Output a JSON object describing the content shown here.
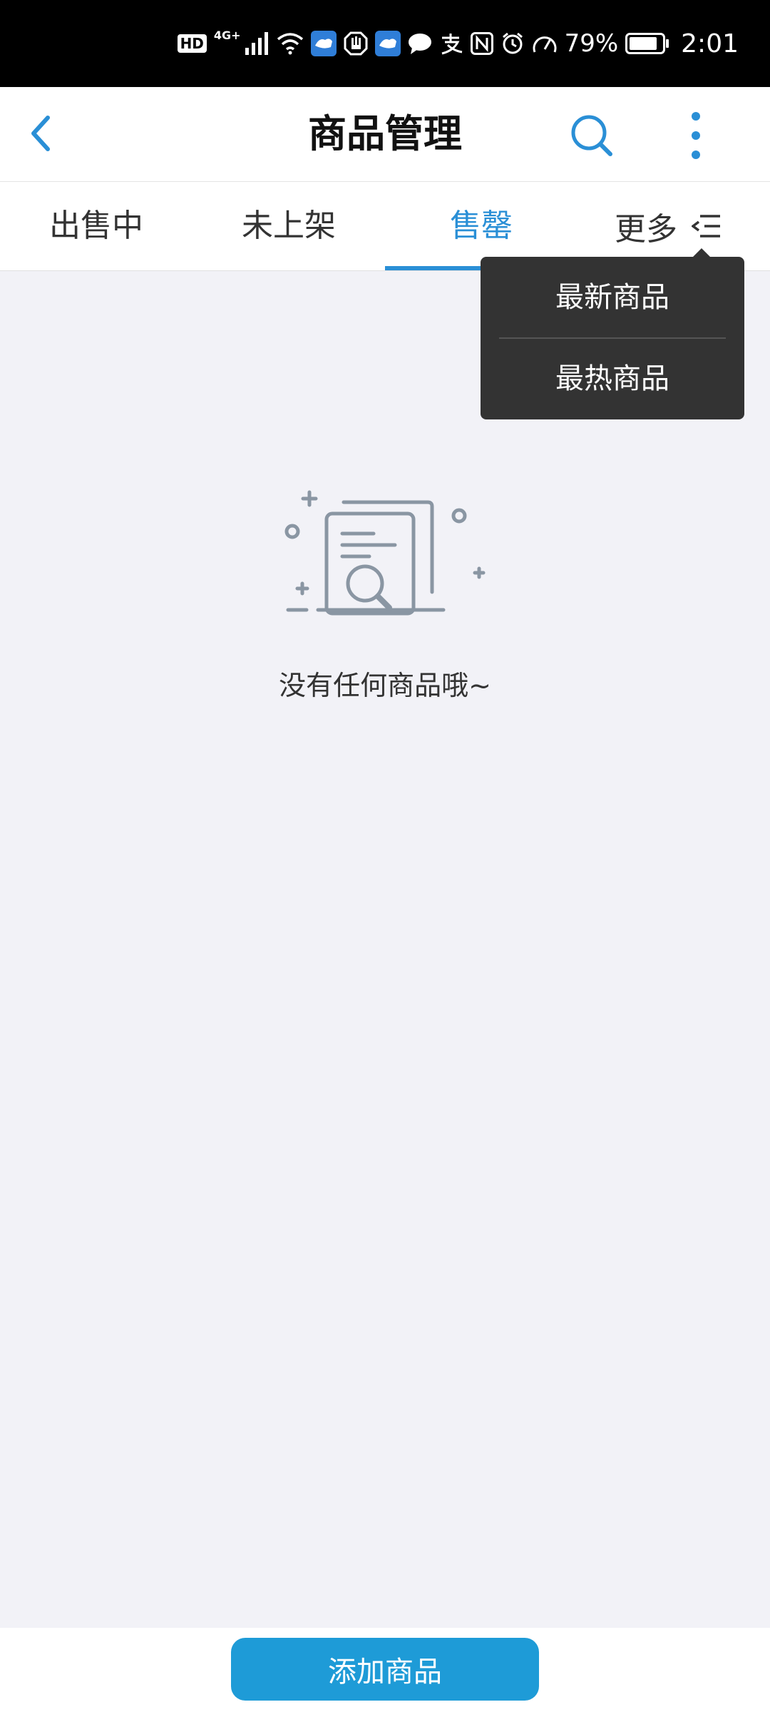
{
  "status_bar": {
    "hd": "HD",
    "network": "4G+",
    "battery": "79%",
    "time": "2:01",
    "icons": [
      "hd-icon",
      "signal-icon",
      "wifi-icon",
      "app-notification-icon",
      "hand-icon",
      "app-notification-icon",
      "message-icon",
      "alipay-icon",
      "nfc-icon",
      "alarm-icon",
      "speedometer-icon",
      "battery-icon"
    ]
  },
  "header": {
    "title": "商品管理",
    "back_icon": "chevron-left-icon",
    "search_icon": "search-icon",
    "more_icon": "more-vertical-icon",
    "accent_color": "#2a8fd6"
  },
  "tabs": {
    "items": [
      {
        "label": "出售中",
        "active": false
      },
      {
        "label": "未上架",
        "active": false
      },
      {
        "label": "售罄",
        "active": true
      }
    ],
    "more_label": "更多",
    "more_icon": "sort-menu-icon"
  },
  "sort_popup": {
    "items": [
      {
        "label": "最新商品"
      },
      {
        "label": "最热商品"
      }
    ]
  },
  "empty_state": {
    "icon": "document-search-icon",
    "message": "没有任何商品哦~"
  },
  "bottom": {
    "add_button_label": "添加商品",
    "button_color": "#1e9bd7"
  }
}
